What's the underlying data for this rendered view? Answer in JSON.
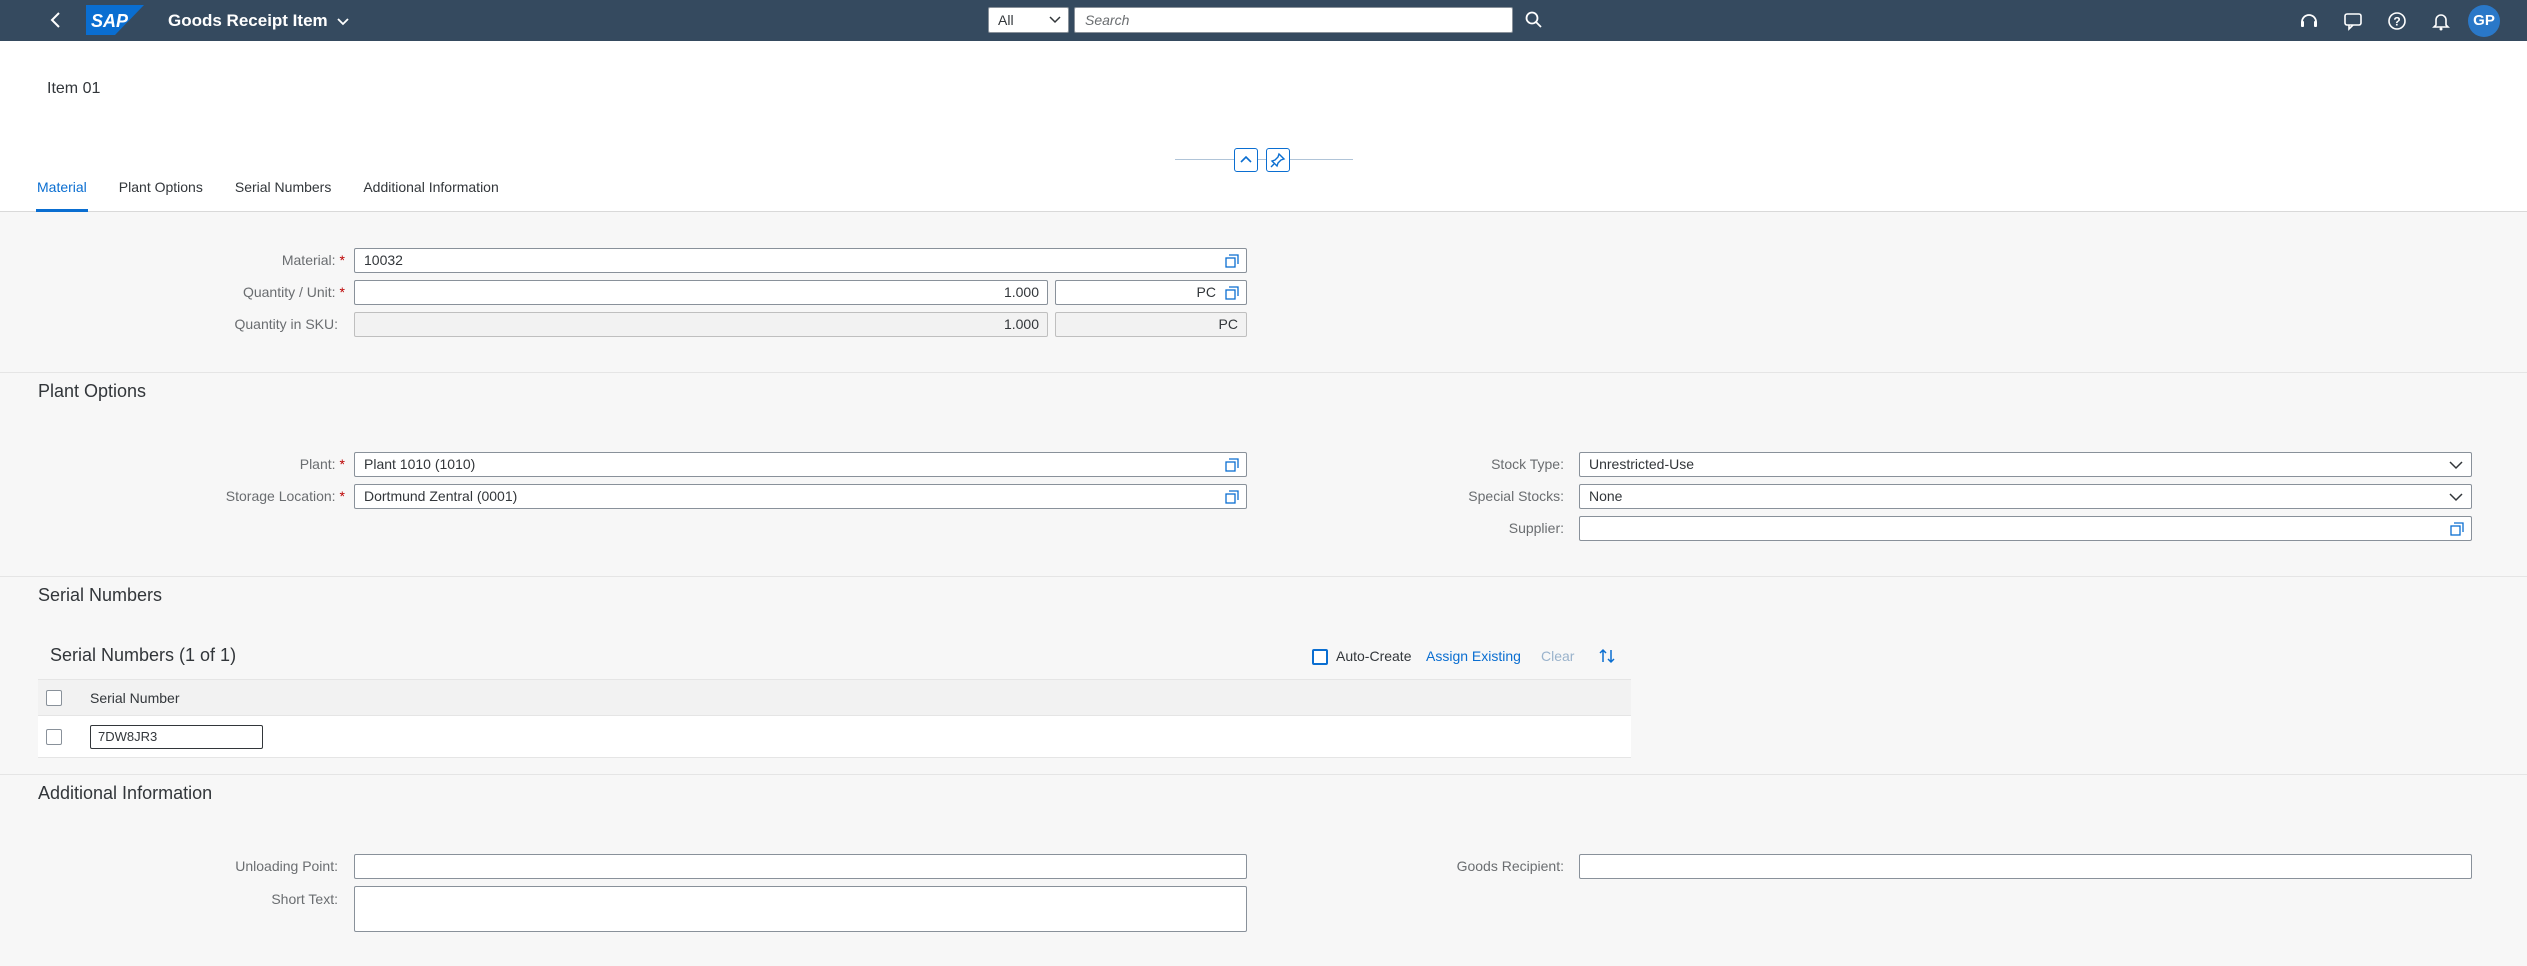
{
  "shell": {
    "app_title": "Goods Receipt Item",
    "search_scope": "All",
    "search_placeholder": "Search",
    "avatar_initials": "GP",
    "brand_color": "#354a5f",
    "accent_color": "#0a6ed1"
  },
  "header": {
    "object_title": "Item 01"
  },
  "tabs": [
    {
      "label": "Material",
      "active": true
    },
    {
      "label": "Plant Options",
      "active": false
    },
    {
      "label": "Serial Numbers",
      "active": false
    },
    {
      "label": "Additional Information",
      "active": false
    }
  ],
  "material": {
    "material_label": "Material:",
    "material_value": "10032",
    "qty_unit_label": "Quantity / Unit:",
    "qty_value": "1.000",
    "unit_value": "PC",
    "qty_sku_label": "Quantity in SKU:",
    "qty_sku_value": "1.000",
    "sku_unit_value": "PC"
  },
  "plant_options": {
    "section_title": "Plant Options",
    "plant_label": "Plant:",
    "plant_value": "Plant 1010 (1010)",
    "storage_label": "Storage Location:",
    "storage_value": "Dortmund Zentral (0001)",
    "stock_type_label": "Stock Type:",
    "stock_type_value": "Unrestricted-Use",
    "special_stocks_label": "Special Stocks:",
    "special_stocks_value": "None",
    "supplier_label": "Supplier:",
    "supplier_value": ""
  },
  "serial_numbers": {
    "section_title": "Serial Numbers",
    "table_title": "Serial Numbers (1 of 1)",
    "auto_create_label": "Auto-Create",
    "assign_existing_label": "Assign Existing",
    "clear_label": "Clear",
    "column_header": "Serial Number",
    "rows": [
      {
        "serial": "7DW8JR3"
      }
    ]
  },
  "additional_info": {
    "section_title": "Additional Information",
    "unloading_point_label": "Unloading Point:",
    "unloading_point_value": "",
    "short_text_label": "Short Text:",
    "short_text_value": "",
    "goods_recipient_label": "Goods Recipient:",
    "goods_recipient_value": ""
  }
}
